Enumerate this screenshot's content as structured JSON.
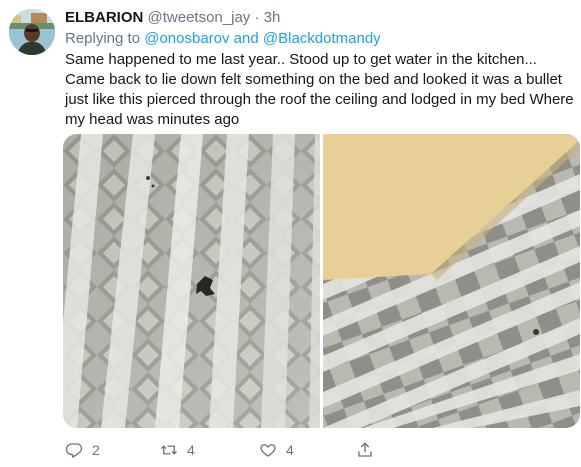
{
  "tweet": {
    "author_name": "ELBARION",
    "handle": "@tweetson_jay",
    "separator": "·",
    "time": "3h",
    "replying_prefix": "Replying to",
    "reply_mention_1": "@onosbarov",
    "reply_and": "and",
    "reply_mention_2": "@Blackdotmandy",
    "text": "Same happened to me last year.. Stood up to get water in the kitchen... Came back to lie down felt something on the bed and looked it was a bullet just like this pierced through the roof the ceiling and lodged in my bed Where my head was minutes ago"
  },
  "actions": {
    "reply_count": "2",
    "retweet_count": "4",
    "like_count": "4"
  },
  "icons": {
    "reply": "reply-icon",
    "retweet": "retweet-icon",
    "like": "heart-icon",
    "share": "share-icon"
  },
  "colors": {
    "link": "#1da1f2",
    "muted": "#657786",
    "text": "#14171a"
  }
}
